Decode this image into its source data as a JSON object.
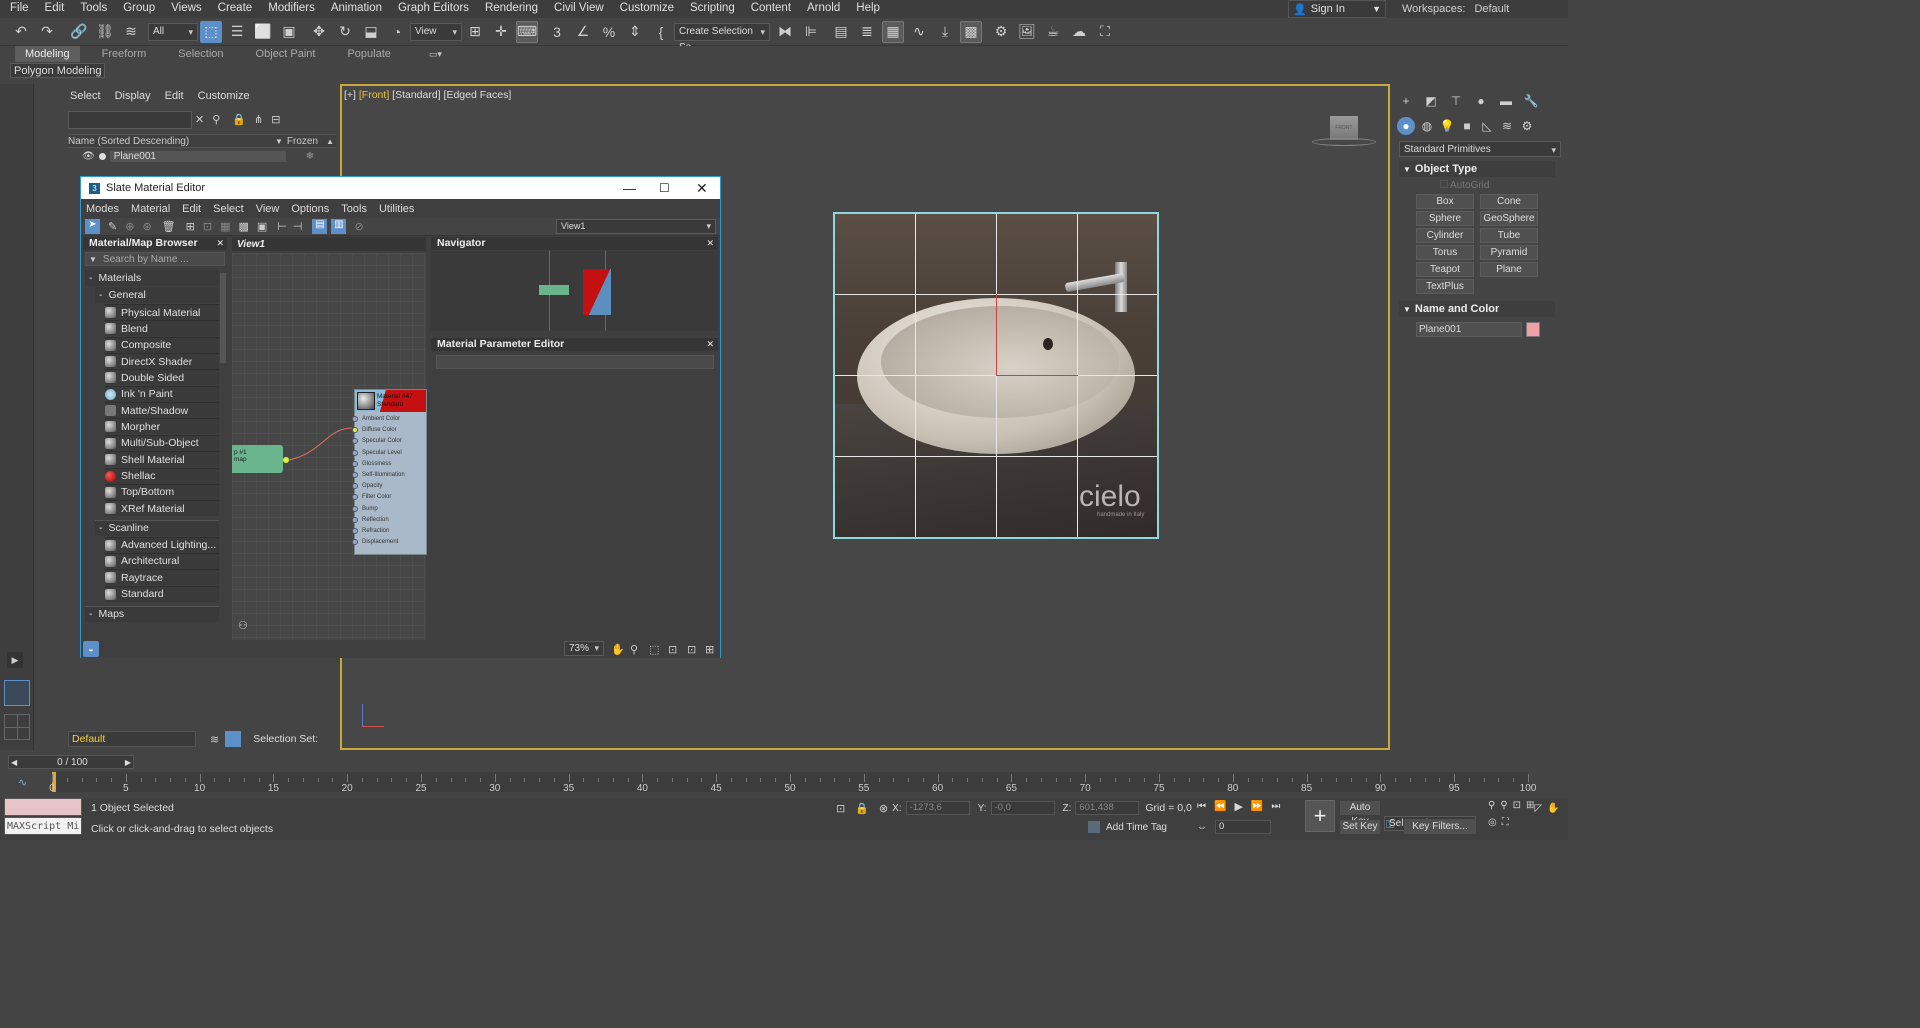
{
  "menubar": [
    "File",
    "Edit",
    "Tools",
    "Group",
    "Views",
    "Create",
    "Modifiers",
    "Animation",
    "Graph Editors",
    "Rendering",
    "Civil View",
    "Customize",
    "Scripting",
    "Content",
    "Arnold",
    "Help"
  ],
  "signin": "Sign In",
  "workspace": {
    "label": "Workspaces:",
    "value": "Default"
  },
  "toolbar": {
    "filter_value": "All",
    "refcoord_value": "View",
    "selection_set_placeholder": "Create Selection Se"
  },
  "ribbon_tabs": [
    "Modeling",
    "Freeform",
    "Selection",
    "Object Paint",
    "Populate"
  ],
  "ribbon_sub": "Polygon Modeling",
  "scene_explorer": {
    "menu": [
      "Select",
      "Display",
      "Edit",
      "Customize"
    ],
    "column_name": "Name (Sorted Descending)",
    "column_frozen": "Frozen",
    "objects": [
      "Plane001"
    ]
  },
  "viewport": {
    "label_plus": "[+]",
    "label_view": "[Front]",
    "label_shading": "[Standard]",
    "label_edged": "[Edged Faces]",
    "viewcube_text": "FRONT"
  },
  "plane_image": {
    "brand": "cielo",
    "tagline": "handmade in Italy"
  },
  "command_panel": {
    "category": "Standard Primitives",
    "object_type_title": "Object Type",
    "autogrid": "AutoGrid",
    "buttons": [
      "Box",
      "Cone",
      "Sphere",
      "GeoSphere",
      "Cylinder",
      "Tube",
      "Torus",
      "Pyramid",
      "Teapot",
      "Plane",
      "TextPlus"
    ],
    "name_color_title": "Name and Color",
    "object_name": "Plane001",
    "object_color": "#f0a0a8"
  },
  "sme": {
    "title": "Slate Material Editor",
    "menu": [
      "Modes",
      "Material",
      "Edit",
      "Select",
      "View",
      "Options",
      "Tools",
      "Utilities"
    ],
    "view_select": "View1",
    "browser_title": "Material/Map Browser",
    "search_placeholder": "Search by Name ...",
    "materials_group": "Materials",
    "general_group": "General",
    "general_items": [
      "Physical Material",
      "Blend",
      "Composite",
      "DirectX Shader",
      "Double Sided",
      "Ink 'n Paint",
      "Matte/Shadow",
      "Morpher",
      "Multi/Sub-Object",
      "Shell Material",
      "Shellac",
      "Top/Bottom",
      "XRef Material"
    ],
    "scanline_group": "Scanline",
    "scanline_items": [
      "Advanced Lighting...",
      "Architectural",
      "Raytrace",
      "Standard"
    ],
    "maps_group": "Maps",
    "view_tab": "View1",
    "navigator_title": "Navigator",
    "param_title": "Material Parameter Editor",
    "node_material_name": "Material #47",
    "node_material_type": "Standard",
    "node_map_name": "p #1",
    "node_map_type": "map",
    "slots": [
      "Ambient Color",
      "Diffuse Color",
      "Specular Color",
      "Specular Level",
      "Glossiness",
      "Self-Illumination",
      "Opacity",
      "Filter Color",
      "Bump",
      "Reflection",
      "Refraction",
      "Displacement"
    ],
    "zoom": "73%"
  },
  "bottom": {
    "layer": "Default",
    "selection_set_label": "Selection Set:",
    "time_position": "0 / 100",
    "ruler_ticks": [
      0,
      5,
      10,
      15,
      20,
      25,
      30,
      35,
      40,
      45,
      50,
      55,
      60,
      65,
      70,
      75,
      80,
      85,
      90,
      95,
      100
    ],
    "maxscript": "MAXScript Mi",
    "status_selected": "1 Object Selected",
    "status_prompt": "Click or click-and-drag to select objects",
    "x_value": "-1273,6",
    "y_value": "-0,0",
    "z_value": "601,438",
    "grid": "Grid = 0,0",
    "add_time_tag": "Add Time Tag",
    "autokey": "Auto Key",
    "setkey": "Set Key",
    "selected": "Selected",
    "key_filters": "Key Filters...",
    "frame": "0"
  }
}
